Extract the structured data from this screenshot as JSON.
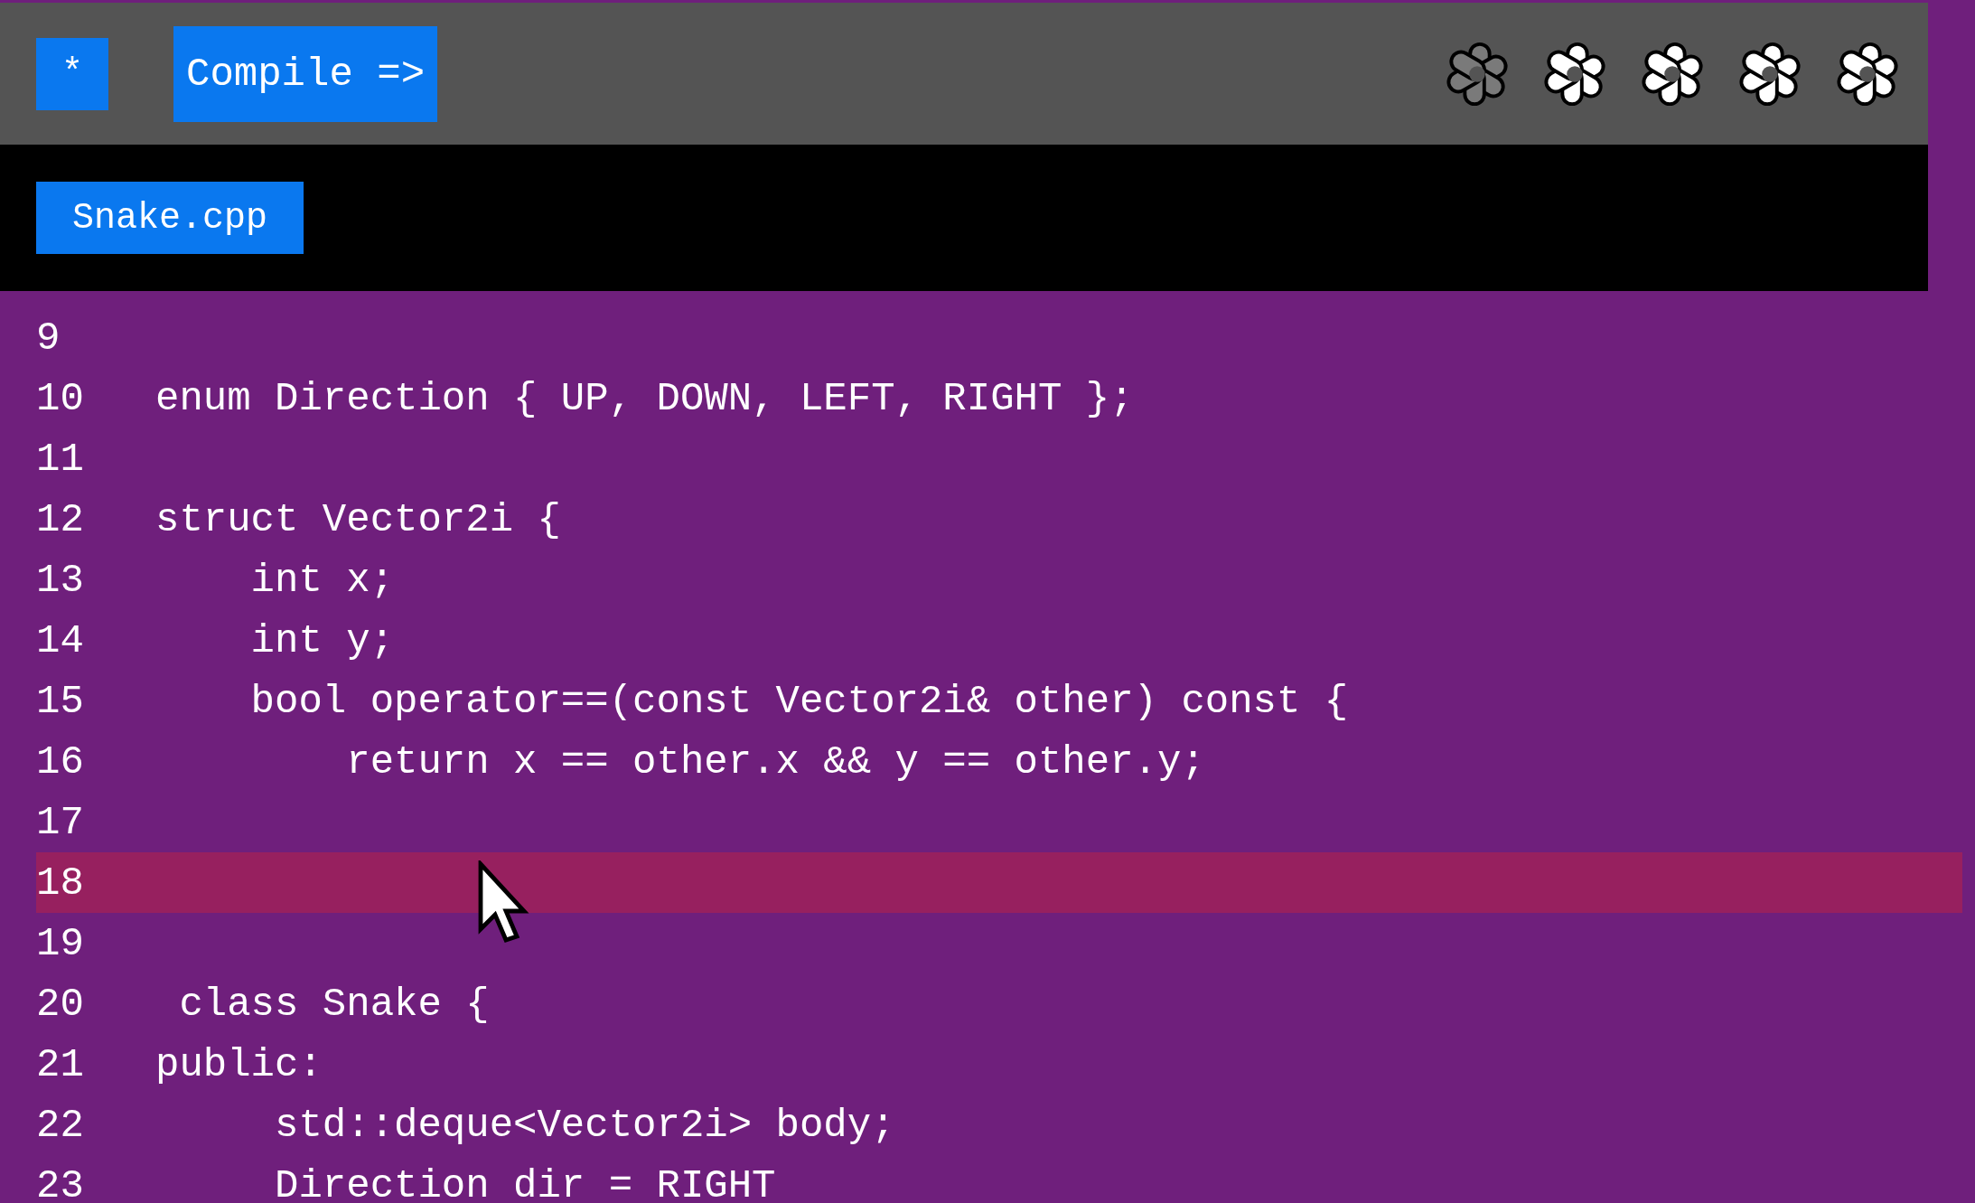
{
  "toolbar": {
    "menu_button": "*",
    "compile_button": "Compile =>",
    "assistants": [
      {
        "dimmed": true
      },
      {
        "dimmed": false
      },
      {
        "dimmed": false
      },
      {
        "dimmed": false
      },
      {
        "dimmed": false
      }
    ]
  },
  "tabs": [
    {
      "label": "Snake.cpp",
      "selected": true
    }
  ],
  "editor": {
    "lines": [
      {
        "number": "9",
        "highlighted": false
      },
      {
        "number": "10",
        "code": "enum Direction { UP, DOWN, LEFT, RIGHT };",
        "highlighted": false
      },
      {
        "number": "11",
        "highlighted": false
      },
      {
        "number": "12",
        "code": "struct Vector2i {",
        "highlighted": false
      },
      {
        "number": "13",
        "code": "    int x;",
        "highlighted": false
      },
      {
        "number": "14",
        "code": "    int y;",
        "highlighted": false
      },
      {
        "number": "15",
        "code": "    bool operator==(const Vector2i& other) const {",
        "highlighted": false
      },
      {
        "number": "16",
        "code": "        return x == other.x && y == other.y;",
        "highlighted": false
      },
      {
        "number": "17",
        "highlighted": false
      },
      {
        "number": "18",
        "highlighted": true
      },
      {
        "number": "19",
        "highlighted": false
      },
      {
        "number": "20",
        "code": " class Snake {",
        "highlighted": false
      },
      {
        "number": "21",
        "code": "public:",
        "highlighted": false
      },
      {
        "number": "22",
        "code": "     std::deque<Vector2i> body;",
        "highlighted": false
      },
      {
        "number": "23",
        "code": "     Direction dir = RIGHT",
        "highlighted": false
      }
    ]
  }
}
